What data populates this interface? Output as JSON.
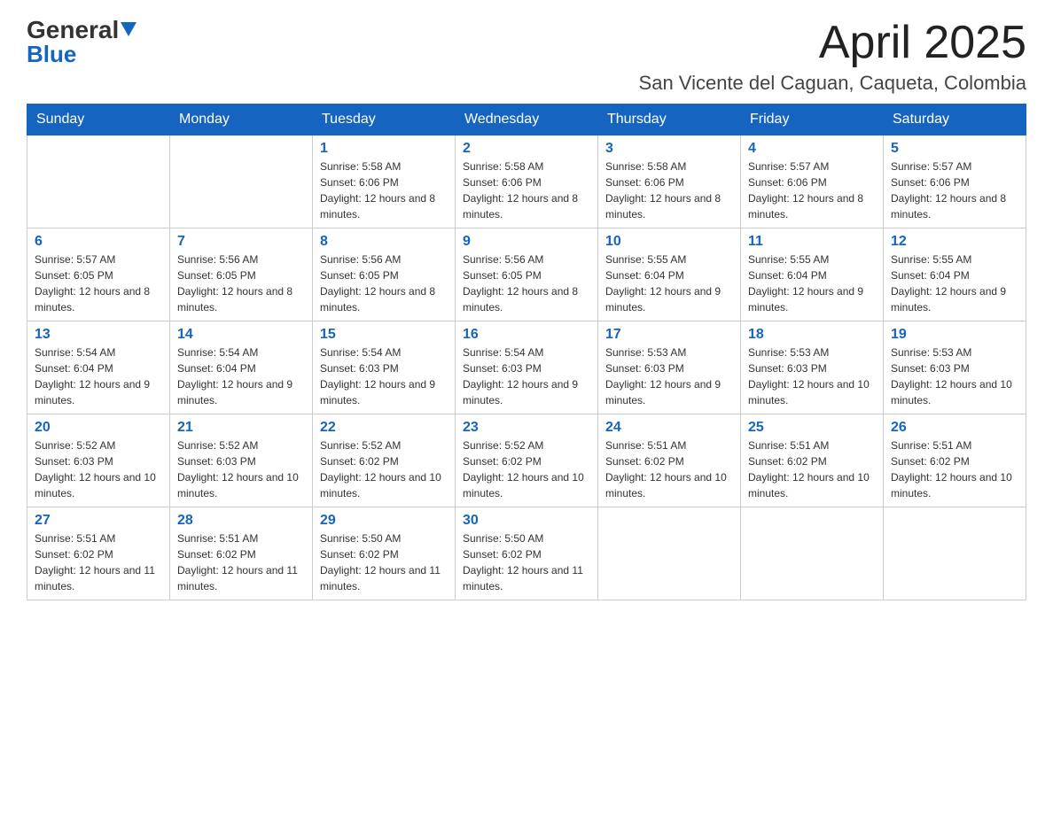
{
  "header": {
    "logo_general": "General",
    "logo_blue": "Blue",
    "month_title": "April 2025",
    "location": "San Vicente del Caguan, Caqueta, Colombia"
  },
  "weekdays": [
    "Sunday",
    "Monday",
    "Tuesday",
    "Wednesday",
    "Thursday",
    "Friday",
    "Saturday"
  ],
  "weeks": [
    [
      {
        "day": "",
        "sunrise": "",
        "sunset": "",
        "daylight": ""
      },
      {
        "day": "",
        "sunrise": "",
        "sunset": "",
        "daylight": ""
      },
      {
        "day": "1",
        "sunrise": "Sunrise: 5:58 AM",
        "sunset": "Sunset: 6:06 PM",
        "daylight": "Daylight: 12 hours and 8 minutes."
      },
      {
        "day": "2",
        "sunrise": "Sunrise: 5:58 AM",
        "sunset": "Sunset: 6:06 PM",
        "daylight": "Daylight: 12 hours and 8 minutes."
      },
      {
        "day": "3",
        "sunrise": "Sunrise: 5:58 AM",
        "sunset": "Sunset: 6:06 PM",
        "daylight": "Daylight: 12 hours and 8 minutes."
      },
      {
        "day": "4",
        "sunrise": "Sunrise: 5:57 AM",
        "sunset": "Sunset: 6:06 PM",
        "daylight": "Daylight: 12 hours and 8 minutes."
      },
      {
        "day": "5",
        "sunrise": "Sunrise: 5:57 AM",
        "sunset": "Sunset: 6:06 PM",
        "daylight": "Daylight: 12 hours and 8 minutes."
      }
    ],
    [
      {
        "day": "6",
        "sunrise": "Sunrise: 5:57 AM",
        "sunset": "Sunset: 6:05 PM",
        "daylight": "Daylight: 12 hours and 8 minutes."
      },
      {
        "day": "7",
        "sunrise": "Sunrise: 5:56 AM",
        "sunset": "Sunset: 6:05 PM",
        "daylight": "Daylight: 12 hours and 8 minutes."
      },
      {
        "day": "8",
        "sunrise": "Sunrise: 5:56 AM",
        "sunset": "Sunset: 6:05 PM",
        "daylight": "Daylight: 12 hours and 8 minutes."
      },
      {
        "day": "9",
        "sunrise": "Sunrise: 5:56 AM",
        "sunset": "Sunset: 6:05 PM",
        "daylight": "Daylight: 12 hours and 8 minutes."
      },
      {
        "day": "10",
        "sunrise": "Sunrise: 5:55 AM",
        "sunset": "Sunset: 6:04 PM",
        "daylight": "Daylight: 12 hours and 9 minutes."
      },
      {
        "day": "11",
        "sunrise": "Sunrise: 5:55 AM",
        "sunset": "Sunset: 6:04 PM",
        "daylight": "Daylight: 12 hours and 9 minutes."
      },
      {
        "day": "12",
        "sunrise": "Sunrise: 5:55 AM",
        "sunset": "Sunset: 6:04 PM",
        "daylight": "Daylight: 12 hours and 9 minutes."
      }
    ],
    [
      {
        "day": "13",
        "sunrise": "Sunrise: 5:54 AM",
        "sunset": "Sunset: 6:04 PM",
        "daylight": "Daylight: 12 hours and 9 minutes."
      },
      {
        "day": "14",
        "sunrise": "Sunrise: 5:54 AM",
        "sunset": "Sunset: 6:04 PM",
        "daylight": "Daylight: 12 hours and 9 minutes."
      },
      {
        "day": "15",
        "sunrise": "Sunrise: 5:54 AM",
        "sunset": "Sunset: 6:03 PM",
        "daylight": "Daylight: 12 hours and 9 minutes."
      },
      {
        "day": "16",
        "sunrise": "Sunrise: 5:54 AM",
        "sunset": "Sunset: 6:03 PM",
        "daylight": "Daylight: 12 hours and 9 minutes."
      },
      {
        "day": "17",
        "sunrise": "Sunrise: 5:53 AM",
        "sunset": "Sunset: 6:03 PM",
        "daylight": "Daylight: 12 hours and 9 minutes."
      },
      {
        "day": "18",
        "sunrise": "Sunrise: 5:53 AM",
        "sunset": "Sunset: 6:03 PM",
        "daylight": "Daylight: 12 hours and 10 minutes."
      },
      {
        "day": "19",
        "sunrise": "Sunrise: 5:53 AM",
        "sunset": "Sunset: 6:03 PM",
        "daylight": "Daylight: 12 hours and 10 minutes."
      }
    ],
    [
      {
        "day": "20",
        "sunrise": "Sunrise: 5:52 AM",
        "sunset": "Sunset: 6:03 PM",
        "daylight": "Daylight: 12 hours and 10 minutes."
      },
      {
        "day": "21",
        "sunrise": "Sunrise: 5:52 AM",
        "sunset": "Sunset: 6:03 PM",
        "daylight": "Daylight: 12 hours and 10 minutes."
      },
      {
        "day": "22",
        "sunrise": "Sunrise: 5:52 AM",
        "sunset": "Sunset: 6:02 PM",
        "daylight": "Daylight: 12 hours and 10 minutes."
      },
      {
        "day": "23",
        "sunrise": "Sunrise: 5:52 AM",
        "sunset": "Sunset: 6:02 PM",
        "daylight": "Daylight: 12 hours and 10 minutes."
      },
      {
        "day": "24",
        "sunrise": "Sunrise: 5:51 AM",
        "sunset": "Sunset: 6:02 PM",
        "daylight": "Daylight: 12 hours and 10 minutes."
      },
      {
        "day": "25",
        "sunrise": "Sunrise: 5:51 AM",
        "sunset": "Sunset: 6:02 PM",
        "daylight": "Daylight: 12 hours and 10 minutes."
      },
      {
        "day": "26",
        "sunrise": "Sunrise: 5:51 AM",
        "sunset": "Sunset: 6:02 PM",
        "daylight": "Daylight: 12 hours and 10 minutes."
      }
    ],
    [
      {
        "day": "27",
        "sunrise": "Sunrise: 5:51 AM",
        "sunset": "Sunset: 6:02 PM",
        "daylight": "Daylight: 12 hours and 11 minutes."
      },
      {
        "day": "28",
        "sunrise": "Sunrise: 5:51 AM",
        "sunset": "Sunset: 6:02 PM",
        "daylight": "Daylight: 12 hours and 11 minutes."
      },
      {
        "day": "29",
        "sunrise": "Sunrise: 5:50 AM",
        "sunset": "Sunset: 6:02 PM",
        "daylight": "Daylight: 12 hours and 11 minutes."
      },
      {
        "day": "30",
        "sunrise": "Sunrise: 5:50 AM",
        "sunset": "Sunset: 6:02 PM",
        "daylight": "Daylight: 12 hours and 11 minutes."
      },
      {
        "day": "",
        "sunrise": "",
        "sunset": "",
        "daylight": ""
      },
      {
        "day": "",
        "sunrise": "",
        "sunset": "",
        "daylight": ""
      },
      {
        "day": "",
        "sunrise": "",
        "sunset": "",
        "daylight": ""
      }
    ]
  ]
}
